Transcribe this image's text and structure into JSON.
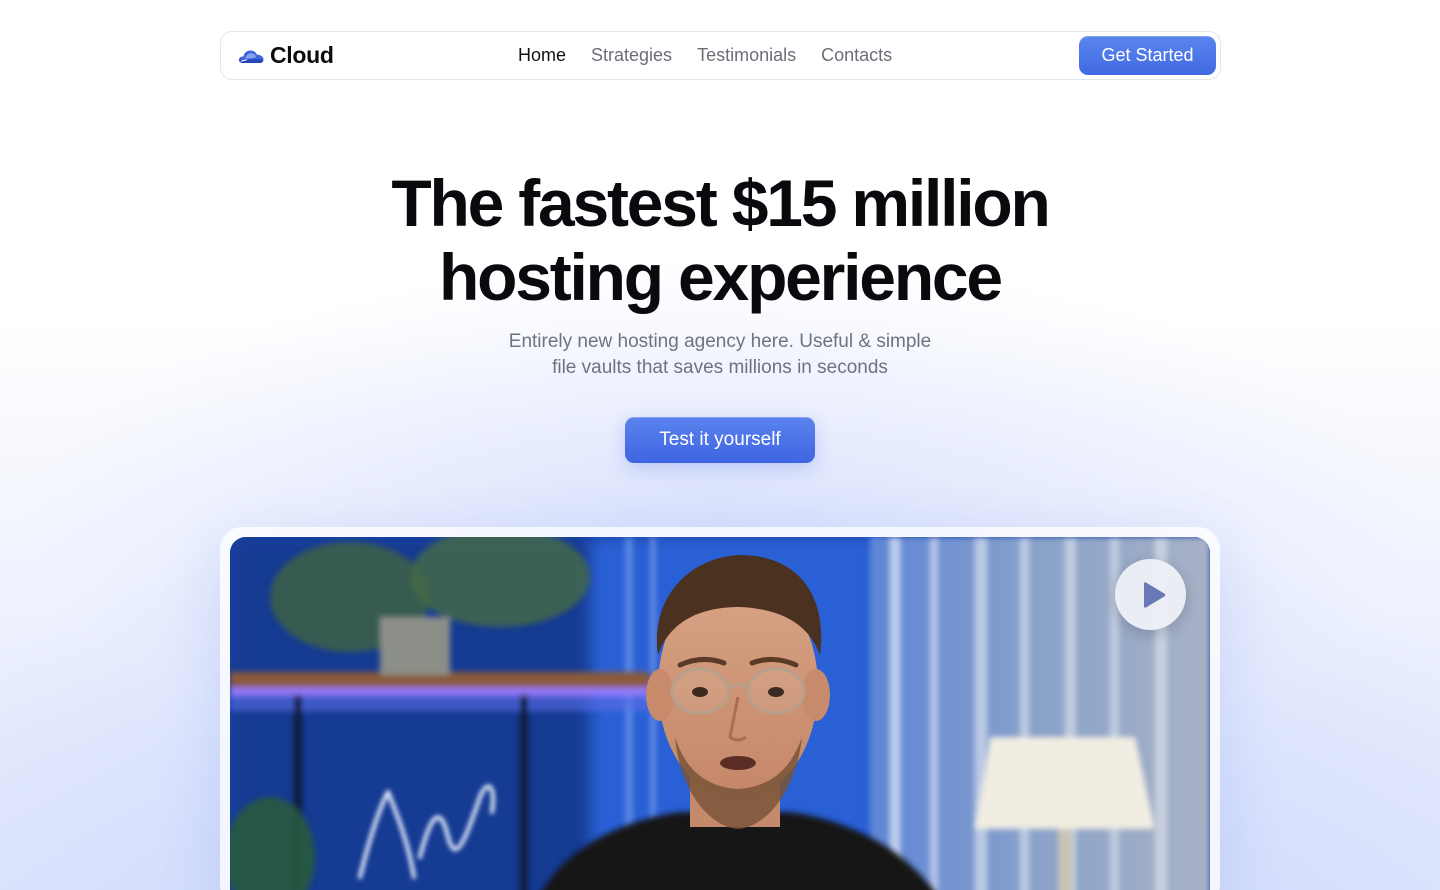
{
  "brand": {
    "name": "Cloud",
    "icon": "cloud-icon"
  },
  "nav": {
    "links": [
      {
        "label": "Home",
        "active": true
      },
      {
        "label": "Strategies",
        "active": false
      },
      {
        "label": "Testimonials",
        "active": false
      },
      {
        "label": "Contacts",
        "active": false
      }
    ],
    "cta_label": "Get Started"
  },
  "hero": {
    "title_line1": "The fastest $15 million",
    "title_line2": "hosting experience",
    "subtitle_line1": "Entirely new hosting agency here. Useful & simple",
    "subtitle_line2": "file vaults that saves millions in seconds",
    "cta_label": "Test it yourself"
  },
  "video": {
    "play_icon": "play-icon"
  },
  "colors": {
    "accent": "#4a72e8",
    "accent_dark": "#3f64e2",
    "text_primary": "#0a0a0e",
    "text_muted": "#6f7280",
    "nav_border": "#e3e6ee"
  }
}
